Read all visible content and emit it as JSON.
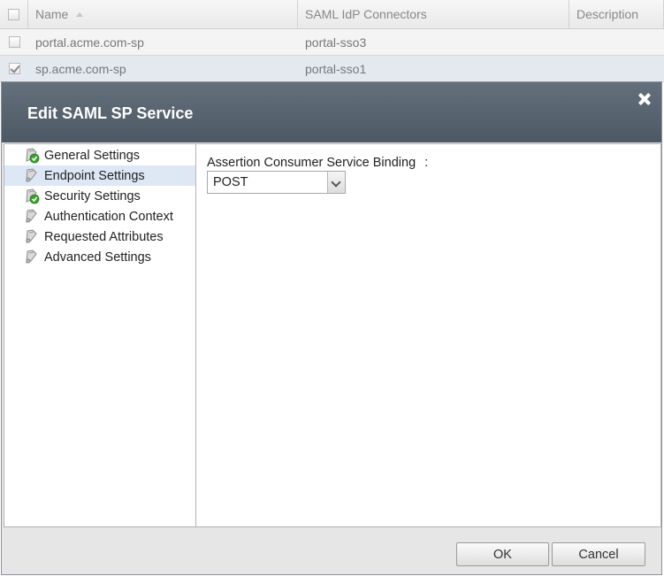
{
  "grid": {
    "columns": {
      "name": "Name",
      "connectors": "SAML IdP Connectors",
      "description": "Description"
    },
    "rows": [
      {
        "name": "portal.acme.com-sp",
        "connectors": "portal-sso3",
        "description": "",
        "checked": false
      },
      {
        "name": "sp.acme.com-sp",
        "connectors": "portal-sso1",
        "description": "",
        "checked": true
      }
    ]
  },
  "dialog": {
    "title": "Edit SAML SP Service",
    "nav": [
      {
        "label": "General Settings",
        "icon": "settings-check-icon",
        "selected": false
      },
      {
        "label": "Endpoint Settings",
        "icon": "settings-icon",
        "selected": true
      },
      {
        "label": "Security Settings",
        "icon": "settings-check-icon",
        "selected": false
      },
      {
        "label": "Authentication Context",
        "icon": "settings-icon",
        "selected": false
      },
      {
        "label": "Requested Attributes",
        "icon": "settings-icon",
        "selected": false
      },
      {
        "label": "Advanced Settings",
        "icon": "settings-icon",
        "selected": false
      }
    ],
    "field": {
      "label": "Assertion Consumer Service Binding",
      "label_suffix": ":",
      "value": "POST"
    },
    "buttons": {
      "ok": "OK",
      "cancel": "Cancel"
    }
  },
  "colors": {
    "header_bg": "#56626e",
    "selected_row": "#e4e9f0",
    "selected_nav": "#dde7f5",
    "check_green": "#3aa02e"
  }
}
